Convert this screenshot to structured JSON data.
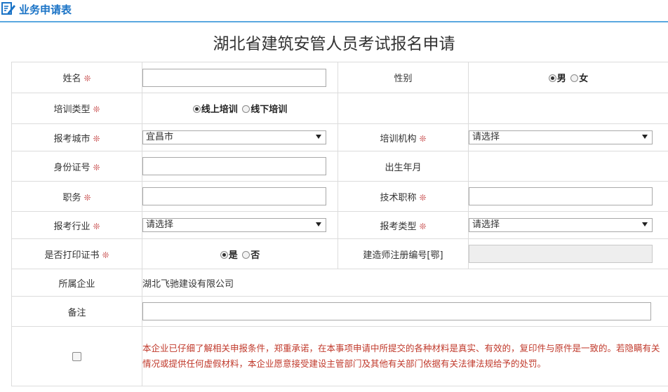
{
  "header": {
    "title": "业务申请表"
  },
  "form": {
    "title": "湖北省建筑安管人员考试报名申请",
    "required_mark": "❊",
    "name": {
      "label": "姓名",
      "value": ""
    },
    "gender": {
      "label": "性别",
      "options": [
        "男",
        "女"
      ],
      "selected": "男"
    },
    "training_type": {
      "label": "培训类型",
      "options": [
        "线上培训",
        "线下培训"
      ],
      "selected": "线上培训"
    },
    "exam_city": {
      "label": "报考城市",
      "value": "宜昌市"
    },
    "training_org": {
      "label": "培训机构",
      "value": "请选择"
    },
    "id_number": {
      "label": "身份证号",
      "value": ""
    },
    "birth": {
      "label": "出生年月",
      "value": ""
    },
    "position": {
      "label": "职务",
      "value": ""
    },
    "tech_title": {
      "label": "技术职称",
      "value": ""
    },
    "industry": {
      "label": "报考行业",
      "value": "请选择"
    },
    "exam_type": {
      "label": "报考类型",
      "value": "请选择"
    },
    "print_cert": {
      "label": "是否打印证书",
      "options": [
        "是",
        "否"
      ],
      "selected": "是"
    },
    "builder_reg_no": {
      "label": "建造师注册编号[鄂]",
      "value": ""
    },
    "company": {
      "label": "所属企业",
      "value": "湖北飞驰建设有限公司"
    },
    "remark": {
      "label": "备注",
      "value": ""
    },
    "declaration": {
      "checked": false,
      "text": "本企业已仔细了解相关申报条件，郑重承诺，在本事项申请中所提交的各种材料是真实、有效的，复印件与原件是一致的。若隐瞒有关情况或提供任何虚假材料，本企业愿意接受建设主管部门及其他有关部门依据有关法律法规给予的处罚。"
    }
  }
}
